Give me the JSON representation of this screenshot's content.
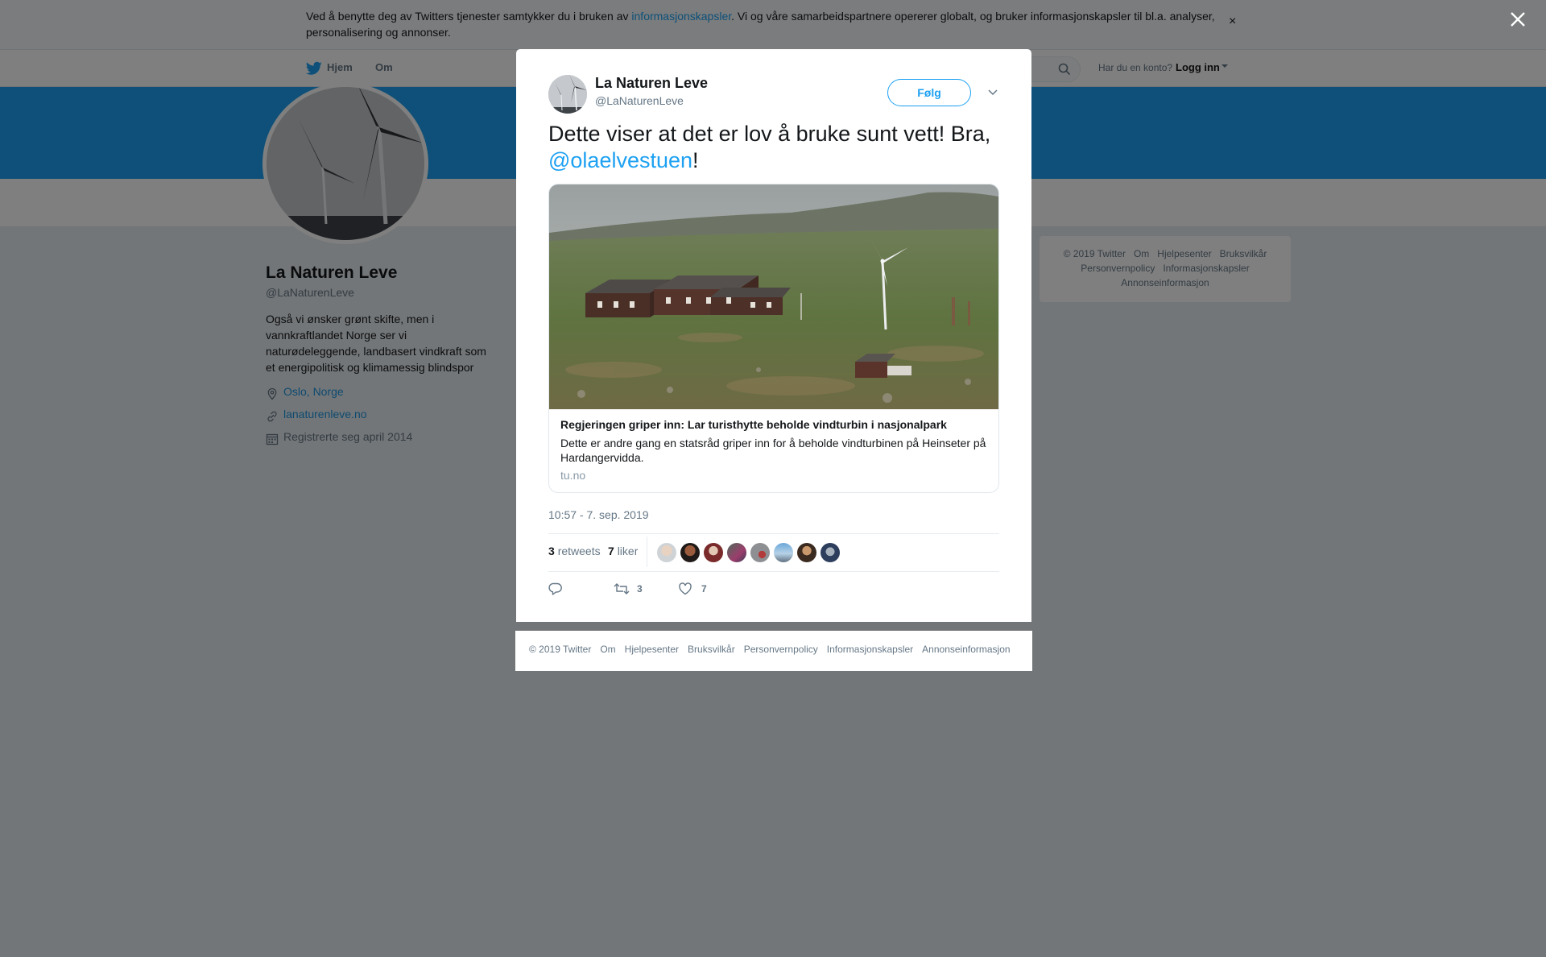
{
  "cookie_bar": {
    "text_before": "Ved å benytte deg av Twitters tjenester samtykker du i bruken av ",
    "link": "informasjonskapsler",
    "text_after": ". Vi og våre samarbeidspartnere opererer globalt, og bruker informasjonskapsler til bl.a. analyser, personalisering og annonser.",
    "close": "×"
  },
  "nav": {
    "home": "Hjem",
    "about": "Om",
    "login_question": "Har du en konto?",
    "login": "Logg inn"
  },
  "profile": {
    "name": "La Naturen Leve",
    "handle": "@LaNaturenLeve",
    "bio": "Også vi ønsker grønt skifte, men i vannkraftlandet Norge ser vi naturødeleggende, landbasert vindkraft som et energipolitisk og klimamessig blindspor",
    "location": "Oslo, Norge",
    "url": "lanaturenleve.no",
    "joined": "Registrerte seg april 2014"
  },
  "sidebar_footer": [
    "© 2019 Twitter",
    "Om",
    "Hjelpesenter",
    "Bruksvilkår",
    "Personvernpolicy",
    "Informasjonskapsler",
    "Annonseinformasjon"
  ],
  "tweet": {
    "name": "La Naturen Leve",
    "handle": "@LaNaturenLeve",
    "follow": "Følg",
    "text_before": "Dette viser at det er lov å bruke sunt vett! Bra, ",
    "mention": "@olaelvestuen",
    "text_after": "!",
    "card": {
      "title": "Regjeringen griper inn: Lar turisthytte beholde vindturbin i nasjonalpark",
      "description": "Dette er andre gang en statsråd griper inn for å beholde vindturbinen på Heinseter på Hardangervidda.",
      "domain": "tu.no"
    },
    "timestamp": "10:57 - 7. sep. 2019",
    "retweets": "3",
    "retweets_label": "retweets",
    "likes": "7",
    "likes_label": "liker",
    "action_retweets": "3",
    "action_likes": "7"
  },
  "modal_footer": [
    "© 2019 Twitter",
    "Om",
    "Hjelpesenter",
    "Bruksvilkår",
    "Personvernpolicy",
    "Informasjonskapsler",
    "Annonseinformasjon"
  ],
  "colors": {
    "twitter_blue": "#1da1f2",
    "link_blue": "#1b95e0",
    "gray_text": "#657786",
    "page_bg": "#e6ecf0"
  }
}
